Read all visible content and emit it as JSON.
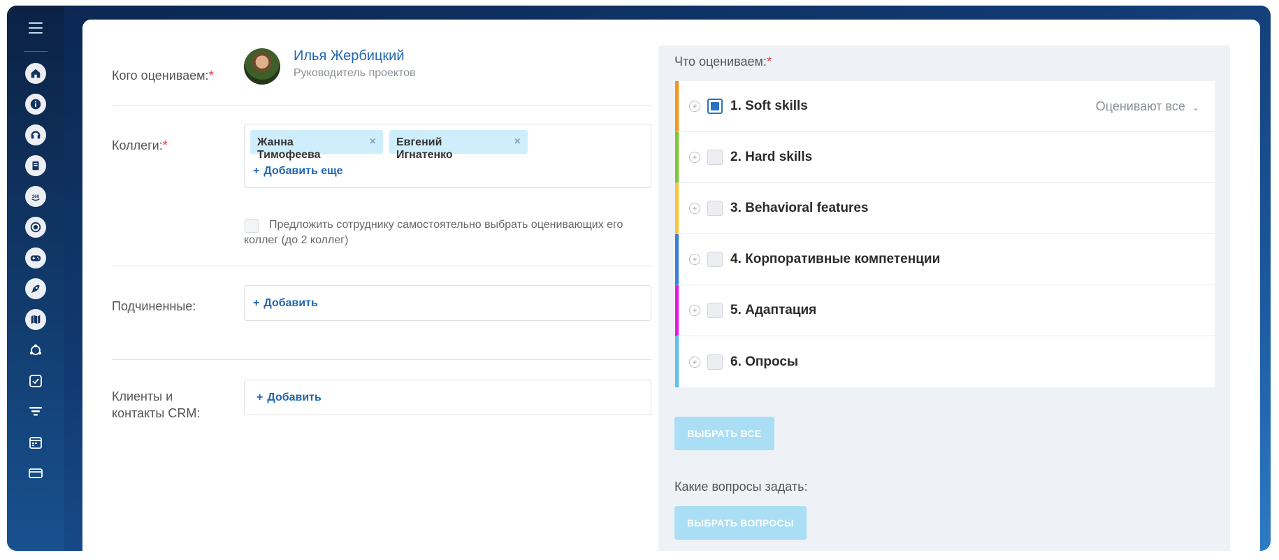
{
  "sidebar": {
    "icons": [
      "menu-icon",
      "home-icon",
      "info-icon",
      "support-icon",
      "document-icon",
      "360-review-icon",
      "target-icon",
      "gamepad-icon",
      "rocket-icon",
      "map-icon",
      "network-icon",
      "checkbox-icon",
      "funnel-icon",
      "calendar-icon",
      "card-icon"
    ],
    "badge_360": "360"
  },
  "form": {
    "who_label": "Кого оцениваем:",
    "required_mark": "*",
    "person": {
      "name": "Илья Жербицкий",
      "role": "Руководитель проектов"
    },
    "colleagues_label": "Коллеги:",
    "colleagues": [
      {
        "name": "Жанна Тимофеева",
        "remove": "×"
      },
      {
        "name": "Евгений Игнатенко",
        "remove": "×"
      }
    ],
    "add_more": "Добавить еще",
    "offer_text": "Предложить сотруднику самостоятельно выбрать оценивающих его коллег (до 2 коллег)",
    "subordinates_label": "Подчиненные:",
    "add": "Добавить",
    "crm_label_line1": "Клиенты и",
    "crm_label_line2": "контакты CRM:",
    "plus": "+"
  },
  "right": {
    "what_label": "Что оцениваем:",
    "items": [
      {
        "name": "1. Soft skills",
        "color": "#f7941d",
        "checked": true,
        "evaluators": "Оценивают все"
      },
      {
        "name": "2. Hard skills",
        "color": "#7bc832",
        "checked": false
      },
      {
        "name": "3. Behavioral features",
        "color": "#f9c537",
        "checked": false
      },
      {
        "name": "4. Корпоративные компетенции",
        "color": "#3d7fd6",
        "checked": false
      },
      {
        "name": "5. Адаптация",
        "color": "#e21ee4",
        "checked": false
      },
      {
        "name": "6. Опросы",
        "color": "#5bc2ee",
        "checked": false
      }
    ],
    "select_all": "ВЫБРАТЬ ВСЕ",
    "questions_label": "Какие вопросы задать:",
    "select_questions": "ВЫБРАТЬ ВОПРОСЫ"
  },
  "colors": {
    "accent": "#2067b0",
    "button": "#a9def5",
    "tag": "#cfeefc",
    "required": "#e53935"
  }
}
